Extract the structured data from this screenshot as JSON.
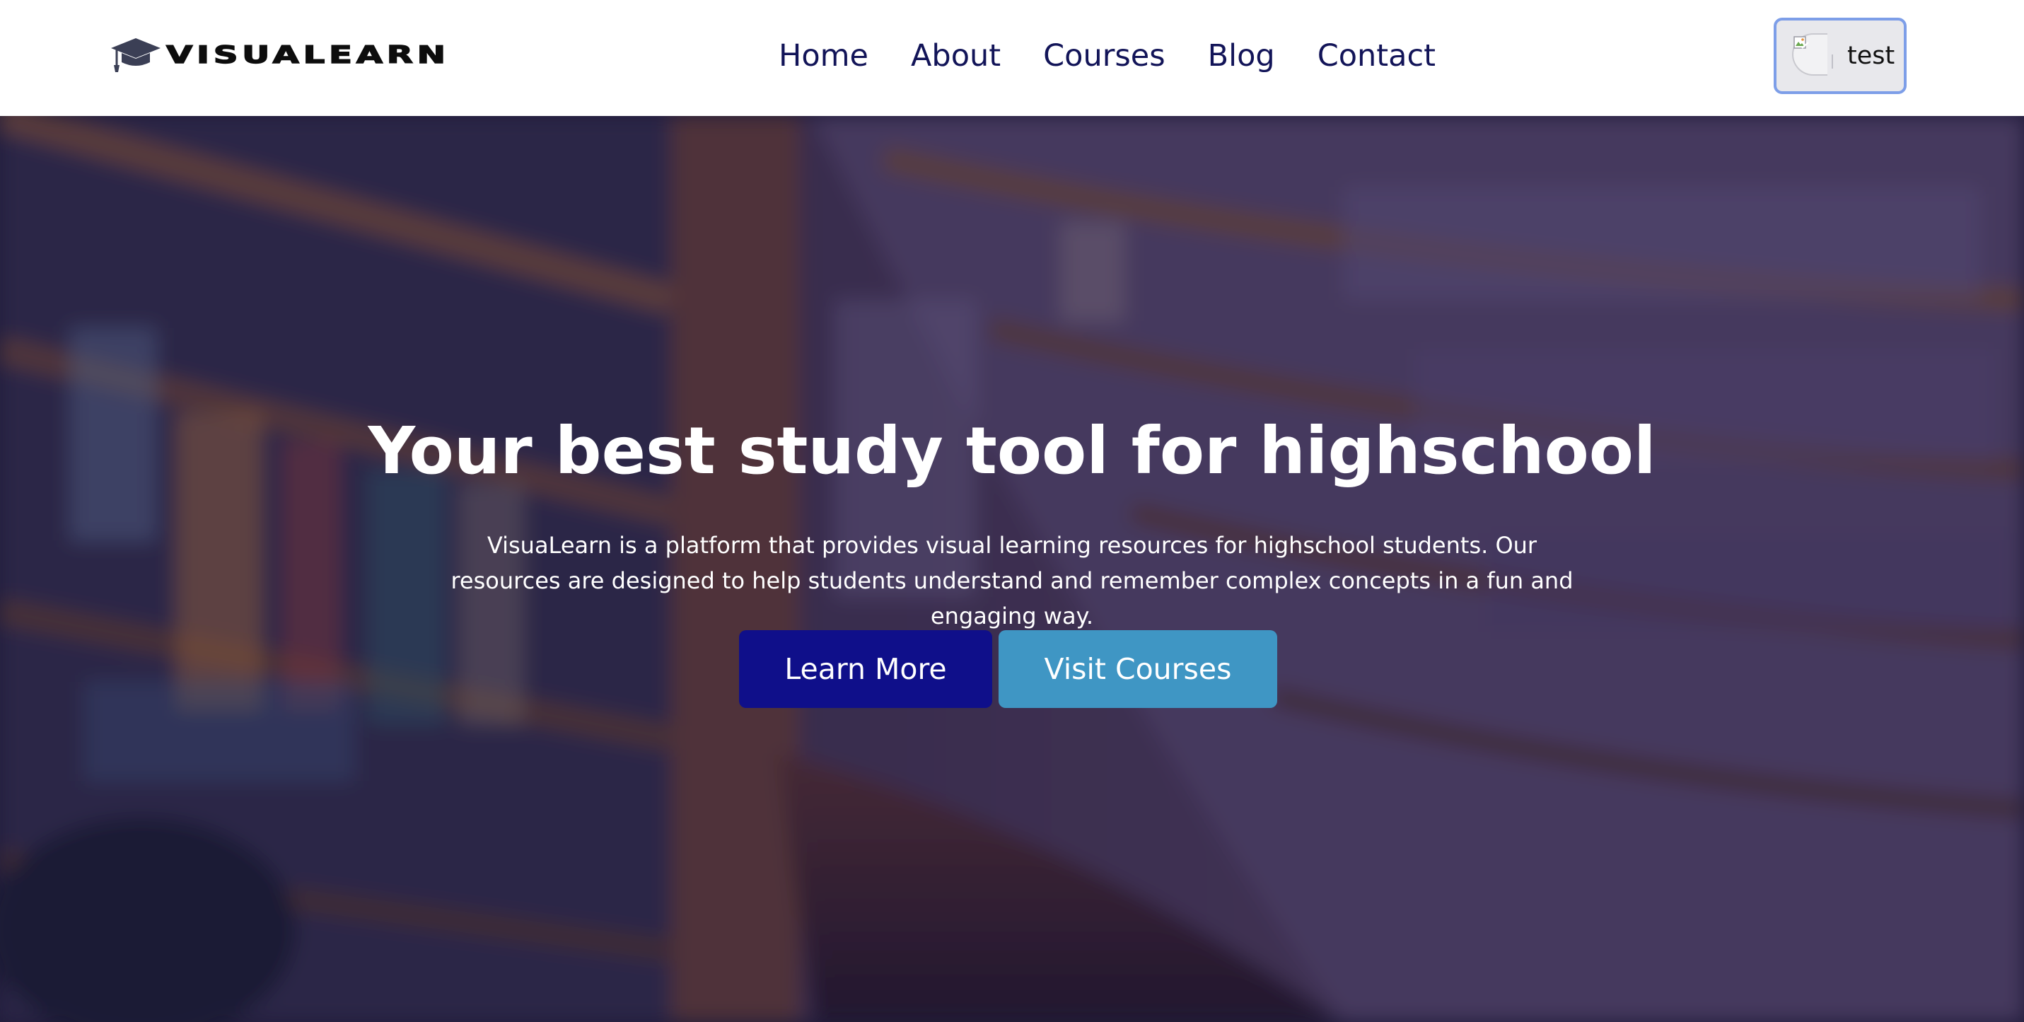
{
  "brand": {
    "name": "VISUALEARN",
    "logo_icon": "graduation-cap-icon"
  },
  "nav": {
    "links": [
      {
        "label": "Home"
      },
      {
        "label": "About"
      },
      {
        "label": "Courses"
      },
      {
        "label": "Blog"
      },
      {
        "label": "Contact"
      }
    ]
  },
  "user": {
    "name": "test",
    "avatar_icon": "broken-image-icon"
  },
  "hero": {
    "title": "Your best study tool for highschool",
    "description": "VisuaLearn is a platform that provides visual learning resources for highschool students. Our resources are designed to help students understand and remember complex concepts in a fun and engaging way.",
    "primary_button": "Learn More",
    "secondary_button": "Visit Courses",
    "background": "blurred-library-bookshelves"
  },
  "colors": {
    "nav_text": "#121458",
    "primary_button": "#0f0f8a",
    "secondary_button": "#3f96c4",
    "user_button_border": "#7d9ee8",
    "hero_text": "#ffffff"
  }
}
